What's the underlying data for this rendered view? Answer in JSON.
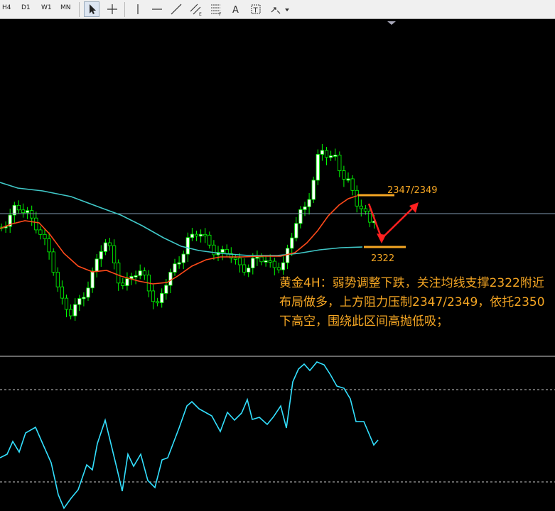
{
  "toolbar": {
    "timeframes": [
      "H4",
      "D1",
      "W1",
      "MN"
    ],
    "tools": [
      {
        "icon": "cursor-arrow-icon"
      },
      {
        "icon": "crosshair-icon"
      },
      {
        "icon": "vertical-line-icon"
      },
      {
        "icon": "horizontal-line-icon"
      },
      {
        "icon": "trendline-icon"
      },
      {
        "icon": "equidistant-channel-icon"
      },
      {
        "icon": "fibonacci-icon"
      },
      {
        "icon": "text-icon"
      },
      {
        "icon": "text-label-icon"
      },
      {
        "icon": "arrow-shapes-dropdown-icon"
      }
    ]
  },
  "annotations": {
    "resistance_label": "2347/2349",
    "support_label": "2322",
    "analysis_text": "黄金4H：弱势调整下跌，关注均线支撑2322附近布局做多，上方阻力压制2347/2349，依托2350下高空，围绕此区间高抛低吸；"
  },
  "colors": {
    "background": "#000000",
    "bull_candle": "#ffffff",
    "bear_candle": "#000000",
    "candle_outline": "#00ff00",
    "ma_fast": "#ff4a1a",
    "ma_slow": "#40c8c8",
    "oscillator": "#33e0ff",
    "annotation": "#f5a623",
    "arrow": "#ff2020"
  }
}
